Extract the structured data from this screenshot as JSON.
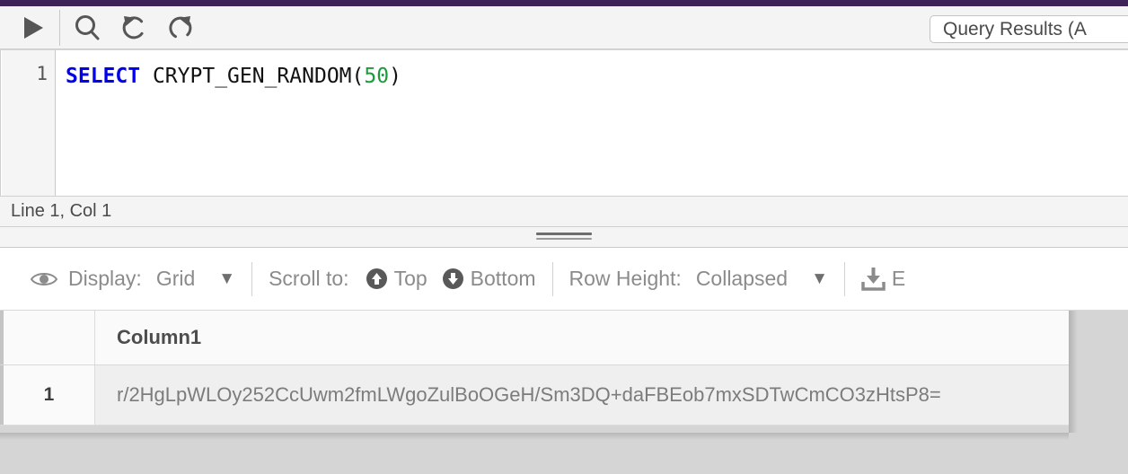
{
  "window": {
    "accent_color": "#3e2359"
  },
  "editor_toolbar": {
    "buttons": [
      {
        "name": "run-query-button",
        "icon": "play-icon",
        "label": "Run"
      },
      {
        "name": "find-button",
        "icon": "search-icon",
        "label": "Find"
      },
      {
        "name": "undo-button",
        "icon": "undo-icon",
        "label": "Undo"
      },
      {
        "name": "redo-button",
        "icon": "redo-icon",
        "label": "Redo"
      }
    ],
    "results_tab_label": "Query Results (A"
  },
  "editor": {
    "line_number": "1",
    "code": {
      "keyword": "SELECT",
      "space": " ",
      "function_open": "CRYPT_GEN_RANDOM(",
      "number": "50",
      "close_paren": ")"
    }
  },
  "status_bar": {
    "position_text": "Line 1, Col 1"
  },
  "results_toolbar": {
    "display_label": "Display:",
    "display_value": "Grid",
    "display_caret": "▼",
    "scroll_label": "Scroll to:",
    "scroll_top_label": "Top",
    "scroll_bottom_label": "Bottom",
    "row_height_label": "Row Height:",
    "row_height_value": "Collapsed",
    "row_height_caret": "▼",
    "export_label": "E"
  },
  "results_grid": {
    "columns": [
      "",
      "Column1"
    ],
    "rows": [
      {
        "index": "1",
        "value": "r/2HgLpWLOy252CcUwm2fmLWgoZulBoOGeH/Sm3DQ+daFBEob7mxSDTwCmCO3zHtsP8="
      }
    ]
  }
}
